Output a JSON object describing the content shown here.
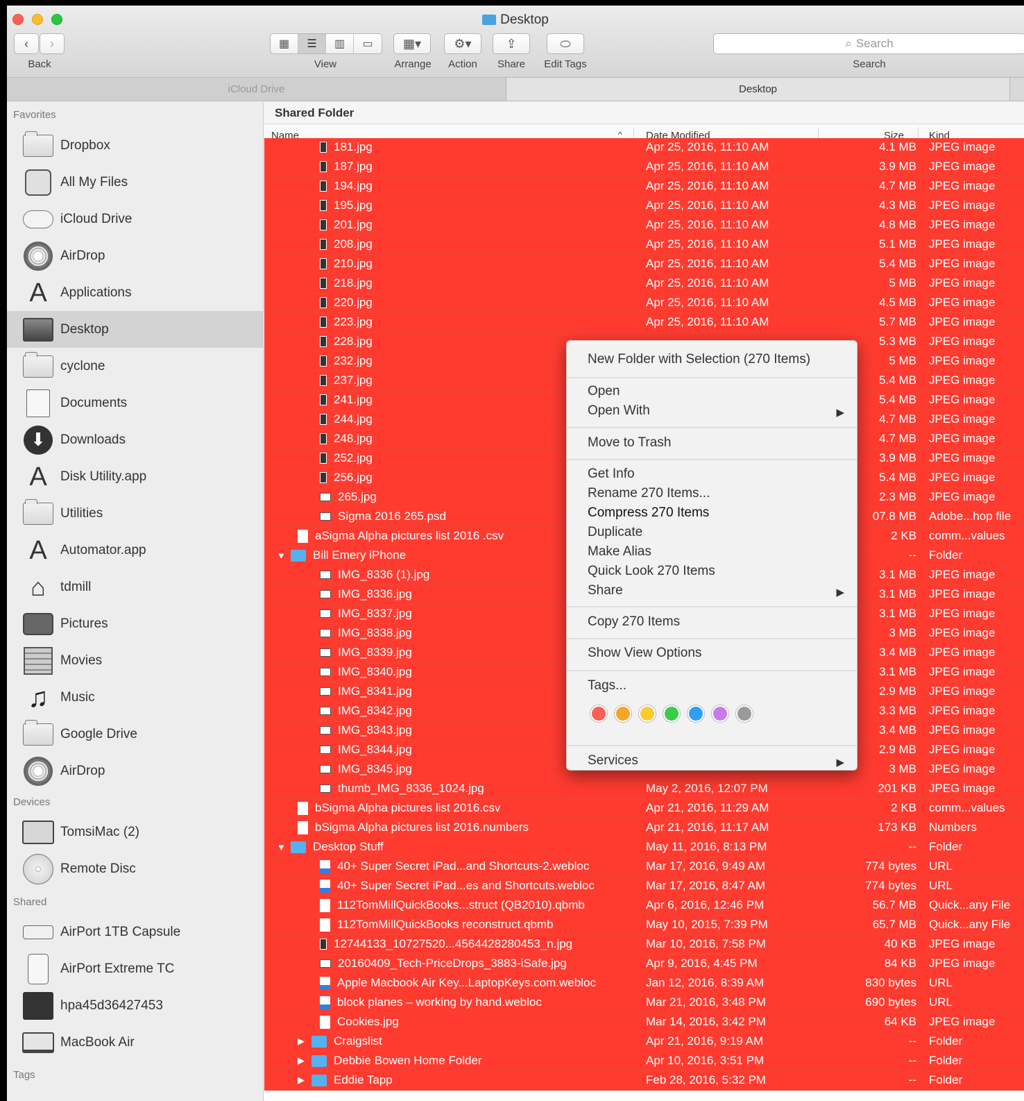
{
  "window": {
    "title": "Desktop",
    "back_label": "Back",
    "view_label": "View",
    "arrange_label": "Arrange",
    "action_label": "Action",
    "share_label": "Share",
    "edit_tags_label": "Edit Tags",
    "search_placeholder": "Search",
    "search_label": "Search"
  },
  "pathbar": {
    "left": "iCloud Drive",
    "right": "Desktop"
  },
  "sidebar": {
    "favorites_header": "Favorites",
    "favorites": [
      {
        "label": "Dropbox",
        "icon": "folder-icon"
      },
      {
        "label": "All My Files",
        "icon": "all-files-icon"
      },
      {
        "label": "iCloud Drive",
        "icon": "cloud-icon"
      },
      {
        "label": "AirDrop",
        "icon": "airdrop-icon"
      },
      {
        "label": "Applications",
        "icon": "applications-icon"
      },
      {
        "label": "Desktop",
        "icon": "desktop-icon",
        "selected": true
      },
      {
        "label": "cyclone",
        "icon": "folder-icon"
      },
      {
        "label": "Documents",
        "icon": "documents-icon"
      },
      {
        "label": "Downloads",
        "icon": "downloads-icon"
      },
      {
        "label": "Disk Utility.app",
        "icon": "app-icon"
      },
      {
        "label": "Utilities",
        "icon": "folder-icon"
      },
      {
        "label": "Automator.app",
        "icon": "app-icon"
      },
      {
        "label": "tdmill",
        "icon": "home-icon"
      },
      {
        "label": "Pictures",
        "icon": "camera-icon"
      },
      {
        "label": "Movies",
        "icon": "film-icon"
      },
      {
        "label": "Music",
        "icon": "music-icon"
      },
      {
        "label": "Google Drive",
        "icon": "folder-icon"
      },
      {
        "label": "AirDrop",
        "icon": "airdrop-icon"
      }
    ],
    "devices_header": "Devices",
    "devices": [
      {
        "label": "TomsiMac (2)",
        "icon": "monitor-icon"
      },
      {
        "label": "Remote Disc",
        "icon": "disc-icon"
      }
    ],
    "shared_header": "Shared",
    "shared": [
      {
        "label": "AirPort 1TB Capsule",
        "icon": "capsule-icon"
      },
      {
        "label": "AirPort Extreme TC",
        "icon": "tower-icon"
      },
      {
        "label": "hpa45d36427453",
        "icon": "imac-icon"
      },
      {
        "label": "MacBook Air",
        "icon": "laptop-icon"
      }
    ],
    "tags_header": "Tags"
  },
  "main": {
    "title": "Shared Folder",
    "columns": {
      "name": "Name",
      "date": "Date Modified",
      "size": "Size",
      "kind": "Kind"
    },
    "rows": [
      {
        "indent": 2,
        "icon": "tall",
        "name": "181.jpg",
        "date": "Apr 25, 2016, 11:10 AM",
        "size": "4.1 MB",
        "kind": "JPEG image"
      },
      {
        "indent": 2,
        "icon": "tall",
        "name": "187.jpg",
        "date": "Apr 25, 2016, 11:10 AM",
        "size": "3.9 MB",
        "kind": "JPEG image"
      },
      {
        "indent": 2,
        "icon": "tall",
        "name": "194.jpg",
        "date": "Apr 25, 2016, 11:10 AM",
        "size": "4.7 MB",
        "kind": "JPEG image"
      },
      {
        "indent": 2,
        "icon": "tall",
        "name": "195.jpg",
        "date": "Apr 25, 2016, 11:10 AM",
        "size": "4.3 MB",
        "kind": "JPEG image"
      },
      {
        "indent": 2,
        "icon": "tall",
        "name": "201.jpg",
        "date": "Apr 25, 2016, 11:10 AM",
        "size": "4.8 MB",
        "kind": "JPEG image"
      },
      {
        "indent": 2,
        "icon": "tall",
        "name": "208.jpg",
        "date": "Apr 25, 2016, 11:10 AM",
        "size": "5.1 MB",
        "kind": "JPEG image"
      },
      {
        "indent": 2,
        "icon": "tall",
        "name": "210.jpg",
        "date": "Apr 25, 2016, 11:10 AM",
        "size": "5.4 MB",
        "kind": "JPEG image"
      },
      {
        "indent": 2,
        "icon": "tall",
        "name": "218.jpg",
        "date": "Apr 25, 2016, 11:10 AM",
        "size": "5 MB",
        "kind": "JPEG image"
      },
      {
        "indent": 2,
        "icon": "tall",
        "name": "220.jpg",
        "date": "Apr 25, 2016, 11:10 AM",
        "size": "4.5 MB",
        "kind": "JPEG image"
      },
      {
        "indent": 2,
        "icon": "tall",
        "name": "223.jpg",
        "date": "Apr 25, 2016, 11:10 AM",
        "size": "5.7 MB",
        "kind": "JPEG image"
      },
      {
        "indent": 2,
        "icon": "tall",
        "name": "228.jpg",
        "date": "",
        "size": "5.3 MB",
        "kind": "JPEG image"
      },
      {
        "indent": 2,
        "icon": "tall",
        "name": "232.jpg",
        "date": "",
        "size": "5 MB",
        "kind": "JPEG image"
      },
      {
        "indent": 2,
        "icon": "tall",
        "name": "237.jpg",
        "date": "",
        "size": "5.4 MB",
        "kind": "JPEG image"
      },
      {
        "indent": 2,
        "icon": "tall",
        "name": "241.jpg",
        "date": "",
        "size": "5.4 MB",
        "kind": "JPEG image"
      },
      {
        "indent": 2,
        "icon": "tall",
        "name": "244.jpg",
        "date": "",
        "size": "4.7 MB",
        "kind": "JPEG image"
      },
      {
        "indent": 2,
        "icon": "tall",
        "name": "248.jpg",
        "date": "",
        "size": "4.7 MB",
        "kind": "JPEG image"
      },
      {
        "indent": 2,
        "icon": "tall",
        "name": "252.jpg",
        "date": "",
        "size": "3.9 MB",
        "kind": "JPEG image"
      },
      {
        "indent": 2,
        "icon": "tall",
        "name": "256.jpg",
        "date": "",
        "size": "5.4 MB",
        "kind": "JPEG image"
      },
      {
        "indent": 2,
        "icon": "img",
        "name": "265.jpg",
        "date": "",
        "size": "2.3 MB",
        "kind": "JPEG image"
      },
      {
        "indent": 2,
        "icon": "img",
        "name": "Sigma 2016 265.psd",
        "date": "",
        "size": "07.8 MB",
        "kind": "Adobe...hop file"
      },
      {
        "indent": 1,
        "icon": "doc",
        "name": "aSigma Alpha pictures list 2016 .csv",
        "date": "",
        "size": "2 KB",
        "kind": "comm...values"
      },
      {
        "indent": 0,
        "icon": "folder",
        "open": true,
        "name": "Bill Emery iPhone",
        "date": "",
        "size": "--",
        "kind": "Folder"
      },
      {
        "indent": 2,
        "icon": "img",
        "name": "IMG_8336 (1).jpg",
        "date": "",
        "size": "3.1 MB",
        "kind": "JPEG image"
      },
      {
        "indent": 2,
        "icon": "img",
        "name": "IMG_8336.jpg",
        "date": "",
        "size": "3.1 MB",
        "kind": "JPEG image"
      },
      {
        "indent": 2,
        "icon": "img",
        "name": "IMG_8337.jpg",
        "date": "",
        "size": "3.1 MB",
        "kind": "JPEG image"
      },
      {
        "indent": 2,
        "icon": "img",
        "name": "IMG_8338.jpg",
        "date": "",
        "size": "3 MB",
        "kind": "JPEG image"
      },
      {
        "indent": 2,
        "icon": "img",
        "name": "IMG_8339.jpg",
        "date": "",
        "size": "3.4 MB",
        "kind": "JPEG image"
      },
      {
        "indent": 2,
        "icon": "img",
        "name": "IMG_8340.jpg",
        "date": "",
        "size": "3.1 MB",
        "kind": "JPEG image"
      },
      {
        "indent": 2,
        "icon": "img",
        "name": "IMG_8341.jpg",
        "date": "",
        "size": "2.9 MB",
        "kind": "JPEG image"
      },
      {
        "indent": 2,
        "icon": "img",
        "name": "IMG_8342.jpg",
        "date": "",
        "size": "3.3 MB",
        "kind": "JPEG image"
      },
      {
        "indent": 2,
        "icon": "img",
        "name": "IMG_8343.jpg",
        "date": "",
        "size": "3.4 MB",
        "kind": "JPEG image"
      },
      {
        "indent": 2,
        "icon": "img",
        "name": "IMG_8344.jpg",
        "date": "",
        "size": "2.9 MB",
        "kind": "JPEG image"
      },
      {
        "indent": 2,
        "icon": "img",
        "name": "IMG_8345.jpg",
        "date": "",
        "size": "3 MB",
        "kind": "JPEG image"
      },
      {
        "indent": 2,
        "icon": "img",
        "name": "thumb_IMG_8336_1024.jpg",
        "date": "May 2, 2016, 12:07 PM",
        "size": "201 KB",
        "kind": "JPEG image"
      },
      {
        "indent": 1,
        "icon": "doc",
        "name": "bSigma Alpha pictures list 2016.csv",
        "date": "Apr 21, 2016, 11:29 AM",
        "size": "2 KB",
        "kind": "comm...values"
      },
      {
        "indent": 1,
        "icon": "doc",
        "name": "bSigma Alpha pictures list 2016.numbers",
        "date": "Apr 21, 2016, 11:17 AM",
        "size": "173 KB",
        "kind": "Numbers"
      },
      {
        "indent": 0,
        "icon": "folder",
        "open": true,
        "name": "Desktop Stuff",
        "date": "May 11, 2016, 8:13 PM",
        "size": "--",
        "kind": "Folder"
      },
      {
        "indent": 2,
        "icon": "url",
        "name": "40+ Super Secret iPad...and Shortcuts-2.webloc",
        "date": "Mar 17, 2016, 9:49 AM",
        "size": "774 bytes",
        "kind": "URL"
      },
      {
        "indent": 2,
        "icon": "url",
        "name": "40+ Super Secret iPad...es and Shortcuts.webloc",
        "date": "Mar 17, 2016, 8:47 AM",
        "size": "774 bytes",
        "kind": "URL"
      },
      {
        "indent": 2,
        "icon": "doc",
        "name": "112TomMillQuickBooks...struct (QB2010).qbmb",
        "date": "Apr 6, 2016, 12:46 PM",
        "size": "56.7 MB",
        "kind": "Quick...any File"
      },
      {
        "indent": 2,
        "icon": "doc",
        "name": "112TomMillQuickBooks reconstruct.qbmb",
        "date": "May 10, 2015, 7:39 PM",
        "size": "65.7 MB",
        "kind": "Quick...any File"
      },
      {
        "indent": 2,
        "icon": "tall",
        "name": "12744133_10727520...4564428280453_n.jpg",
        "date": "Mar 10, 2016, 7:58 PM",
        "size": "40 KB",
        "kind": "JPEG image"
      },
      {
        "indent": 2,
        "icon": "img",
        "name": "20160409_Tech-PriceDrops_3883-iSafe.jpg",
        "date": "Apr 9, 2016, 4:45 PM",
        "size": "84 KB",
        "kind": "JPEG image"
      },
      {
        "indent": 2,
        "icon": "url",
        "name": "Apple Macbook Air Key...LaptopKeys.com.webloc",
        "date": "Jan 12, 2016, 8:39 AM",
        "size": "830 bytes",
        "kind": "URL"
      },
      {
        "indent": 2,
        "icon": "url",
        "name": "block planes – working by hand.webloc",
        "date": "Mar 21, 2016, 3:48 PM",
        "size": "690 bytes",
        "kind": "URL"
      },
      {
        "indent": 2,
        "icon": "doc",
        "name": "Cookies.jpg",
        "date": "Mar 14, 2016, 3:42 PM",
        "size": "64 KB",
        "kind": "JPEG image"
      },
      {
        "indent": 1,
        "icon": "folder",
        "open": false,
        "name": "Craigslist",
        "date": "Apr 21, 2016, 9:19 AM",
        "size": "--",
        "kind": "Folder"
      },
      {
        "indent": 1,
        "icon": "folder",
        "open": false,
        "name": "Debbie Bowen Home Folder",
        "date": "Apr 10, 2016, 3:51 PM",
        "size": "--",
        "kind": "Folder"
      },
      {
        "indent": 1,
        "icon": "folder",
        "open": false,
        "name": "Eddie Tapp",
        "date": "Feb 28, 2016, 5:32 PM",
        "size": "--",
        "kind": "Folder"
      }
    ]
  },
  "context_menu": {
    "new_folder": "New Folder with Selection (270 Items)",
    "open": "Open",
    "open_with": "Open With",
    "move_to_trash": "Move to Trash",
    "get_info": "Get Info",
    "rename": "Rename 270 Items...",
    "compress": "Compress 270 Items",
    "duplicate": "Duplicate",
    "make_alias": "Make Alias",
    "quick_look": "Quick Look 270 Items",
    "share": "Share",
    "copy": "Copy 270 Items",
    "show_view_options": "Show View Options",
    "tags": "Tags...",
    "services": "Services",
    "tag_colors": [
      "#fc5f57",
      "#f5a623",
      "#fccb2e",
      "#3ccb4b",
      "#2f9ff5",
      "#c77de9",
      "#9a9a9a"
    ]
  }
}
